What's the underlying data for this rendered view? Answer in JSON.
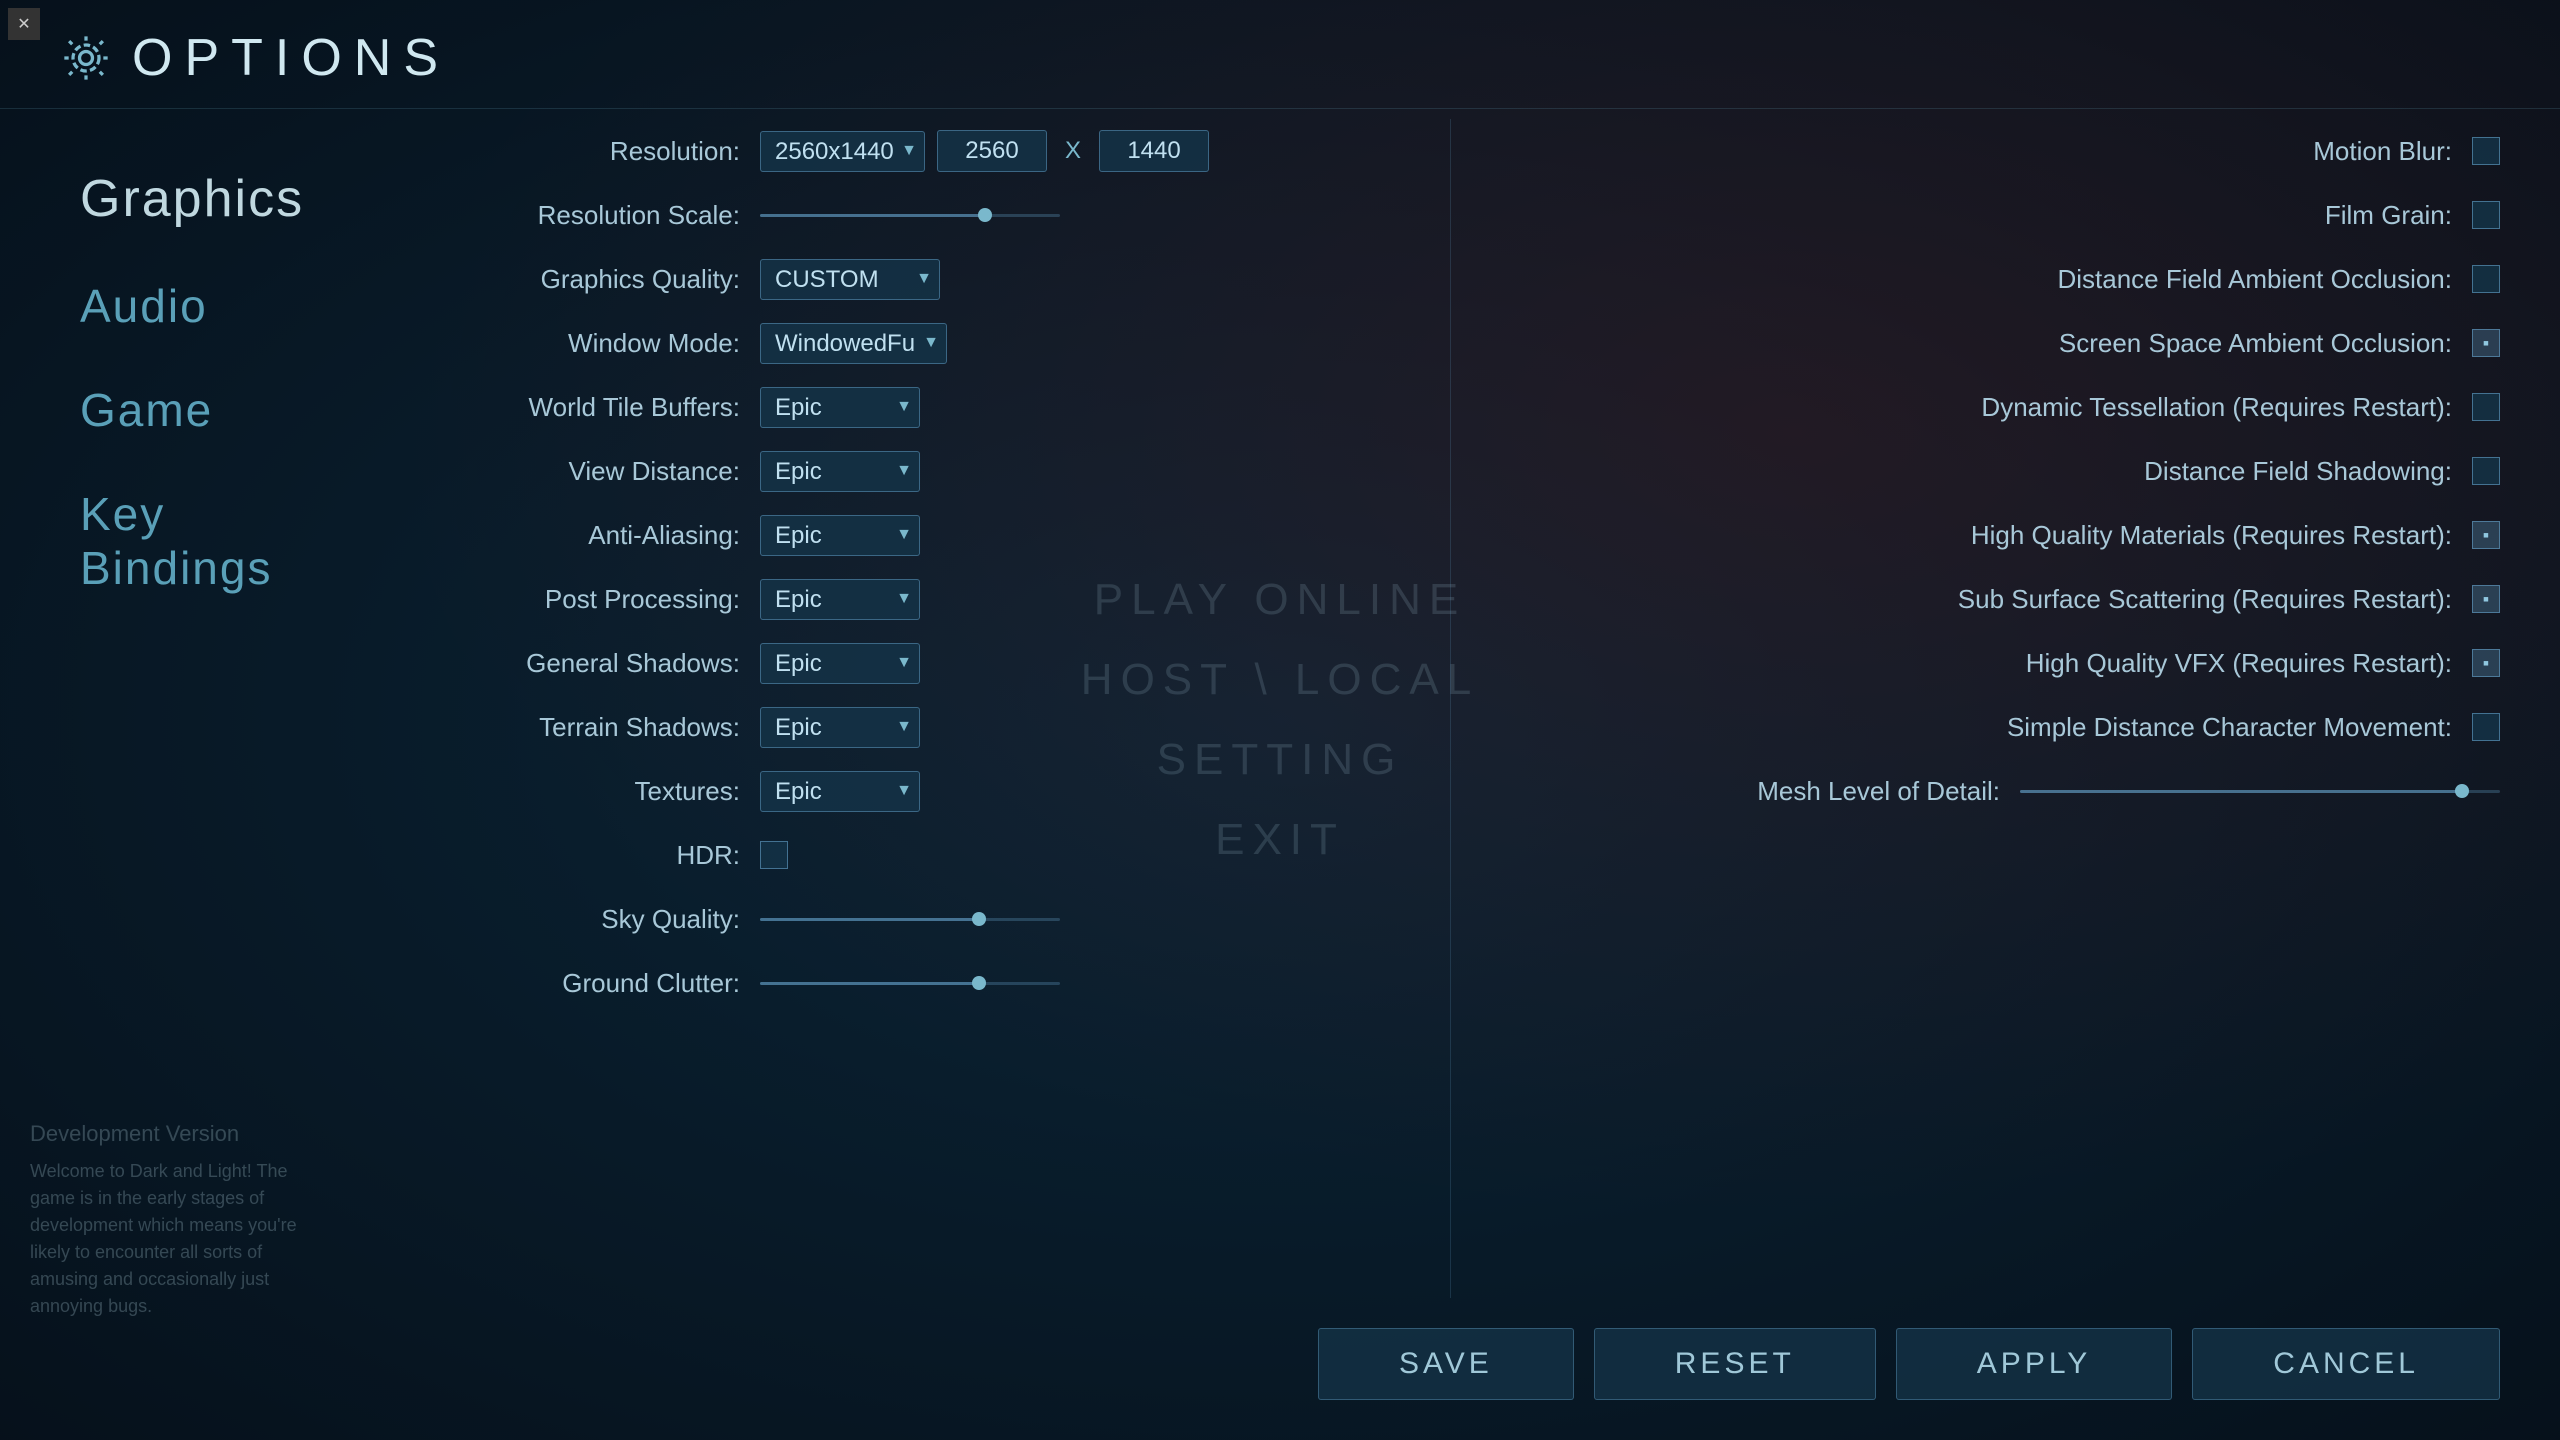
{
  "window": {
    "title": "OPTIONS",
    "close_label": "✕"
  },
  "header": {
    "title": "OPTIONS",
    "gear_symbol": "⚙"
  },
  "sidebar": {
    "items": [
      {
        "id": "graphics",
        "label": "Graphics",
        "active": true
      },
      {
        "id": "audio",
        "label": "Audio",
        "active": false
      },
      {
        "id": "game",
        "label": "Game",
        "active": false
      },
      {
        "id": "key-bindings",
        "label": "Key Bindings",
        "active": false
      }
    ],
    "dev_version_title": "Development Version",
    "dev_version_text": "Welcome to Dark and Light! The game is in the early stages of development which means you're likely to encounter all sorts of amusing and occasionally just annoying bugs."
  },
  "center_menu": {
    "items": [
      "PLAY ONLINE",
      "HOST \\ LOCAL",
      "SETTING",
      "EXIT"
    ]
  },
  "settings": {
    "left": [
      {
        "id": "resolution",
        "label": "Resolution:",
        "type": "resolution",
        "dropdown_value": "2560x1440",
        "width": "2560",
        "height": "1440"
      },
      {
        "id": "resolution-scale",
        "label": "Resolution Scale:",
        "type": "slider",
        "fill_pct": 75
      },
      {
        "id": "graphics-quality",
        "label": "Graphics Quality:",
        "type": "dropdown",
        "value": "CUSTOM"
      },
      {
        "id": "window-mode",
        "label": "Window Mode:",
        "type": "dropdown",
        "value": "WindowedFu"
      },
      {
        "id": "world-tile-buffers",
        "label": "World Tile Buffers:",
        "type": "dropdown",
        "value": "Epic"
      },
      {
        "id": "view-distance",
        "label": "View Distance:",
        "type": "dropdown",
        "value": "Epic"
      },
      {
        "id": "anti-aliasing",
        "label": "Anti-Aliasing:",
        "type": "dropdown",
        "value": "Epic"
      },
      {
        "id": "post-processing",
        "label": "Post Processing:",
        "type": "dropdown",
        "value": "Epic"
      },
      {
        "id": "general-shadows",
        "label": "General Shadows:",
        "type": "dropdown",
        "value": "Epic"
      },
      {
        "id": "terrain-shadows",
        "label": "Terrain Shadows:",
        "type": "dropdown",
        "value": "Epic"
      },
      {
        "id": "textures",
        "label": "Textures:",
        "type": "dropdown",
        "value": "Epic"
      },
      {
        "id": "hdr",
        "label": "HDR:",
        "type": "checkbox",
        "checked": false
      },
      {
        "id": "sky-quality",
        "label": "Sky Quality:",
        "type": "slider",
        "fill_pct": 73
      },
      {
        "id": "ground-clutter",
        "label": "Ground Clutter:",
        "type": "slider",
        "fill_pct": 73
      }
    ],
    "right": [
      {
        "id": "motion-blur",
        "label": "Motion Blur:",
        "type": "checkbox",
        "checked": false
      },
      {
        "id": "film-grain",
        "label": "Film Grain:",
        "type": "checkbox",
        "checked": false
      },
      {
        "id": "df-ambient-occlusion",
        "label": "Distance Field Ambient Occlusion:",
        "type": "checkbox",
        "checked": false
      },
      {
        "id": "ss-ambient-occlusion",
        "label": "Screen Space Ambient Occlusion:",
        "type": "checkbox",
        "checked": true
      },
      {
        "id": "dynamic-tessellation",
        "label": "Dynamic Tessellation (Requires Restart):",
        "type": "checkbox",
        "checked": false
      },
      {
        "id": "df-shadowing",
        "label": "Distance Field Shadowing:",
        "type": "checkbox",
        "checked": false
      },
      {
        "id": "hq-materials",
        "label": "High Quality Materials (Requires Restart):",
        "type": "checkbox",
        "checked": true
      },
      {
        "id": "sub-surface-scattering",
        "label": "Sub Surface Scattering (Requires Restart):",
        "type": "checkbox",
        "checked": true
      },
      {
        "id": "hq-vfx",
        "label": "High Quality VFX (Requires Restart):",
        "type": "checkbox",
        "checked": true
      },
      {
        "id": "simple-distance",
        "label": "Simple Distance Character Movement:",
        "type": "checkbox",
        "checked": false
      },
      {
        "id": "mesh-lod",
        "label": "Mesh Level of Detail:",
        "type": "slider",
        "fill_pct": 92,
        "wide": true
      }
    ]
  },
  "footer": {
    "buttons": [
      {
        "id": "save",
        "label": "SAVE"
      },
      {
        "id": "reset",
        "label": "RESET"
      },
      {
        "id": "apply",
        "label": "APPLY"
      },
      {
        "id": "cancel",
        "label": "CANCEL"
      }
    ]
  }
}
